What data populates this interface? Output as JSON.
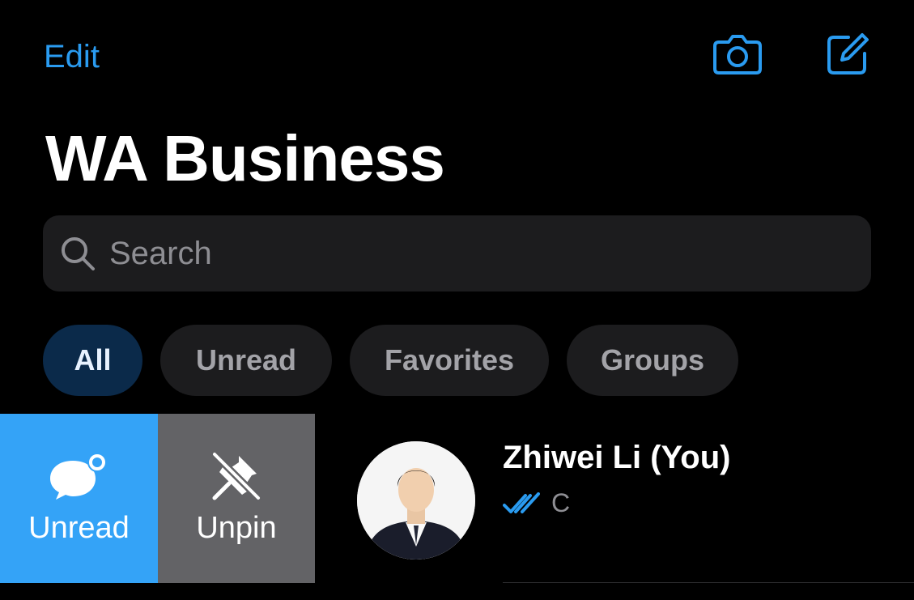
{
  "header": {
    "edit_label": "Edit",
    "title": "WA Business",
    "camera_icon": "camera-icon",
    "compose_icon": "compose-icon"
  },
  "search": {
    "placeholder": "Search",
    "value": ""
  },
  "filters": [
    {
      "label": "All",
      "active": true
    },
    {
      "label": "Unread",
      "active": false
    },
    {
      "label": "Favorites",
      "active": false
    },
    {
      "label": "Groups",
      "active": false
    }
  ],
  "swipe_actions": {
    "unread_label": "Unread",
    "unpin_label": "Unpin"
  },
  "chat": {
    "name": "Zhiwei Li (You)",
    "preview": "C",
    "status_icon": "double-check-icon"
  },
  "colors": {
    "accent": "#2a9bf0",
    "unread_action": "#34a3f7",
    "unpin_action": "#636366",
    "active_chip": "#0b2a4a"
  }
}
